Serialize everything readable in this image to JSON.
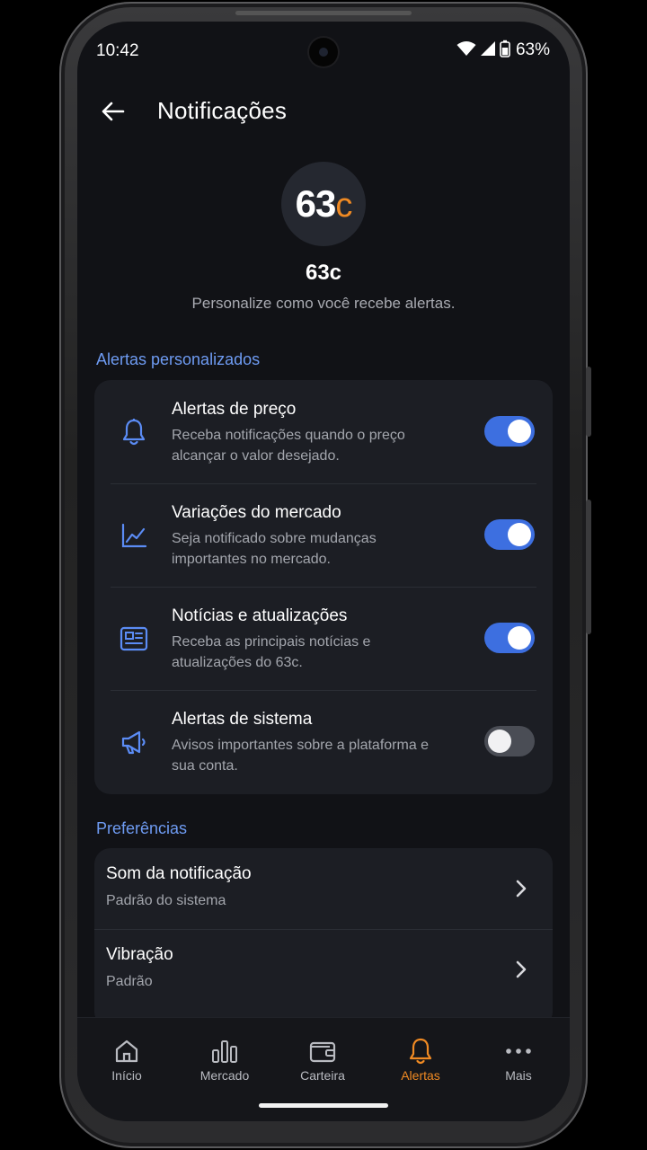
{
  "status_bar": {
    "time": "10:42",
    "battery": "63%"
  },
  "app_bar": {
    "title": "Notificações"
  },
  "header": {
    "logo_main": "63",
    "logo_accent": "c",
    "app_name": "63c",
    "subtitle": "Personalize como você recebe alertas."
  },
  "sections": {
    "alerts_title": "Alertas personalizados",
    "prefs_title": "Preferências"
  },
  "alerts": [
    {
      "title": "Alertas de preço",
      "desc": "Receba notificações quando o preço alcançar o valor desejado.",
      "enabled": true,
      "icon": "bell-icon"
    },
    {
      "title": "Variações do mercado",
      "desc": "Seja notificado sobre mudanças importantes no mercado.",
      "enabled": true,
      "icon": "chart-line-icon"
    },
    {
      "title": "Notícias e atualizações",
      "desc": "Receba as principais notícias e atualizações do 63c.",
      "enabled": true,
      "icon": "newspaper-icon"
    },
    {
      "title": "Alertas de sistema",
      "desc": "Avisos importantes sobre a plataforma e sua conta.",
      "enabled": false,
      "icon": "megaphone-icon"
    }
  ],
  "preferences": [
    {
      "title": "Som da notificação",
      "value": "Padrão do sistema"
    },
    {
      "title": "Vibração",
      "value": "Padrão"
    }
  ],
  "nav": [
    {
      "label": "Início",
      "icon": "home-icon",
      "active": false
    },
    {
      "label": "Mercado",
      "icon": "bar-chart-icon",
      "active": false
    },
    {
      "label": "Carteira",
      "icon": "wallet-icon",
      "active": false
    },
    {
      "label": "Alertas",
      "icon": "bell-icon",
      "active": true
    },
    {
      "label": "Mais",
      "icon": "more-icon",
      "active": false
    }
  ],
  "colors": {
    "accent_blue": "#3d6fe0",
    "accent_orange": "#f08a23",
    "section_blue": "#6e9bf2",
    "background": "#111216",
    "card": "#1c1e24"
  }
}
